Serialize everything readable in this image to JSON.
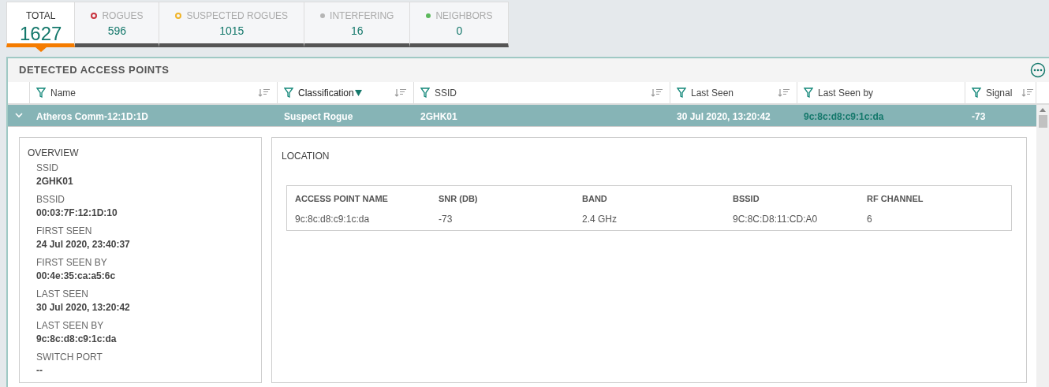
{
  "tabs": [
    {
      "label": "TOTAL",
      "value": "1627",
      "selected": true
    },
    {
      "label": "ROGUES",
      "value": "596",
      "selected": false,
      "kind": "ring",
      "color": "#c8343f"
    },
    {
      "label": "SUSPECTED ROGUES",
      "value": "1015",
      "selected": false,
      "kind": "ring",
      "color": "#f0b429"
    },
    {
      "label": "INTERFERING",
      "value": "16",
      "selected": false,
      "kind": "dot",
      "color": "#b5b5b5"
    },
    {
      "label": "NEIGHBORS",
      "value": "0",
      "selected": false,
      "kind": "dot",
      "color": "#5cb85c"
    }
  ],
  "panel": {
    "title": "DETECTED ACCESS POINTS"
  },
  "table": {
    "columns": [
      {
        "label": "Name",
        "sortable": true,
        "filter_active": false
      },
      {
        "label": "Classification",
        "sortable": true,
        "filter_active": true
      },
      {
        "label": "SSID",
        "sortable": true,
        "filter_active": false
      },
      {
        "label": "Last Seen",
        "sortable": true,
        "filter_active": false
      },
      {
        "label": "Last Seen by",
        "sortable": false,
        "filter_active": false
      },
      {
        "label": "Signal",
        "sortable": true,
        "filter_active": false
      }
    ],
    "rows": [
      {
        "selected": true,
        "expanded": true,
        "cells": [
          {
            "text": "Atheros Comm-12:1D:1D",
            "kind": "plain"
          },
          {
            "text": "Suspect Rogue",
            "kind": "plain"
          },
          {
            "text": "2GHK01",
            "kind": "plain"
          },
          {
            "text": "30 Jul 2020, 13:20:42",
            "kind": "plain"
          },
          {
            "text": "9c:8c:d8:c9:1c:da",
            "kind": "link"
          },
          {
            "text": "-73",
            "kind": "plain"
          }
        ]
      }
    ]
  },
  "overview": {
    "title": "OVERVIEW",
    "fields": [
      {
        "label": "SSID",
        "value": "2GHK01"
      },
      {
        "label": "BSSID",
        "value": "00:03:7F:12:1D:10"
      },
      {
        "label": "FIRST SEEN",
        "value": "24 Jul 2020, 23:40:37"
      },
      {
        "label": "FIRST SEEN BY",
        "value": "00:4e:35:ca:a5:6c"
      },
      {
        "label": "LAST SEEN",
        "value": "30 Jul 2020, 13:20:42"
      },
      {
        "label": "LAST SEEN BY",
        "value": "9c:8c:d8:c9:1c:da"
      },
      {
        "label": "SWITCH PORT",
        "value": "--"
      }
    ]
  },
  "location": {
    "title": "LOCATION",
    "columns": [
      "ACCESS POINT NAME",
      "SNR (DB)",
      "BAND",
      "BSSID",
      "RF CHANNEL"
    ],
    "rows": [
      [
        "9c:8c:d8:c9:1c:da",
        "-73",
        "2.4 GHz",
        "9C:8C:D8:11:CD:A0",
        "6"
      ]
    ]
  }
}
